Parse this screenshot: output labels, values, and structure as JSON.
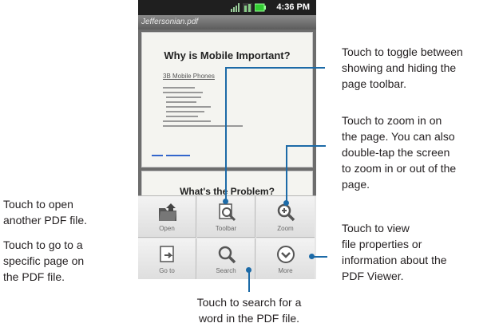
{
  "status_bar": {
    "time": "4:36 PM",
    "icons": [
      "signal-icon",
      "network-icon",
      "battery-icon"
    ]
  },
  "title_bar": {
    "text": "Jeffersonian.pdf"
  },
  "document": {
    "page1_heading": "Why is Mobile Important?",
    "page1_subheading": "3B Mobile Phones",
    "page2_heading": "What's the Problem?"
  },
  "toolbar": {
    "buttons": [
      {
        "label": "Open",
        "icon": "folder-open-icon"
      },
      {
        "label": "Toolbar",
        "icon": "toolbar-icon"
      },
      {
        "label": "Zoom",
        "icon": "zoom-in-icon"
      },
      {
        "label": "Go to",
        "icon": "goto-page-icon"
      },
      {
        "label": "Search",
        "icon": "search-icon"
      },
      {
        "label": "More",
        "icon": "more-icon"
      }
    ]
  },
  "annotations": {
    "open": "Touch to open\nanother PDF file.",
    "goto": "Touch to go to a\nspecific page on\nthe PDF file.",
    "toolbar": "Touch to toggle between\nshowing and hiding the\npage toolbar.",
    "zoom": "Touch to zoom in on\nthe page. You can also\ndouble-tap the screen\nto zoom in or out of the\npage.",
    "more": "Touch to view\nfile properties or\ninformation about the\nPDF Viewer.",
    "search": "Touch to search for a\nword in the PDF file."
  },
  "colors": {
    "leader_line": "#1c6aa7",
    "toolbar_bg": "#e7e7e7",
    "status_bar": "#1f1f1f"
  }
}
